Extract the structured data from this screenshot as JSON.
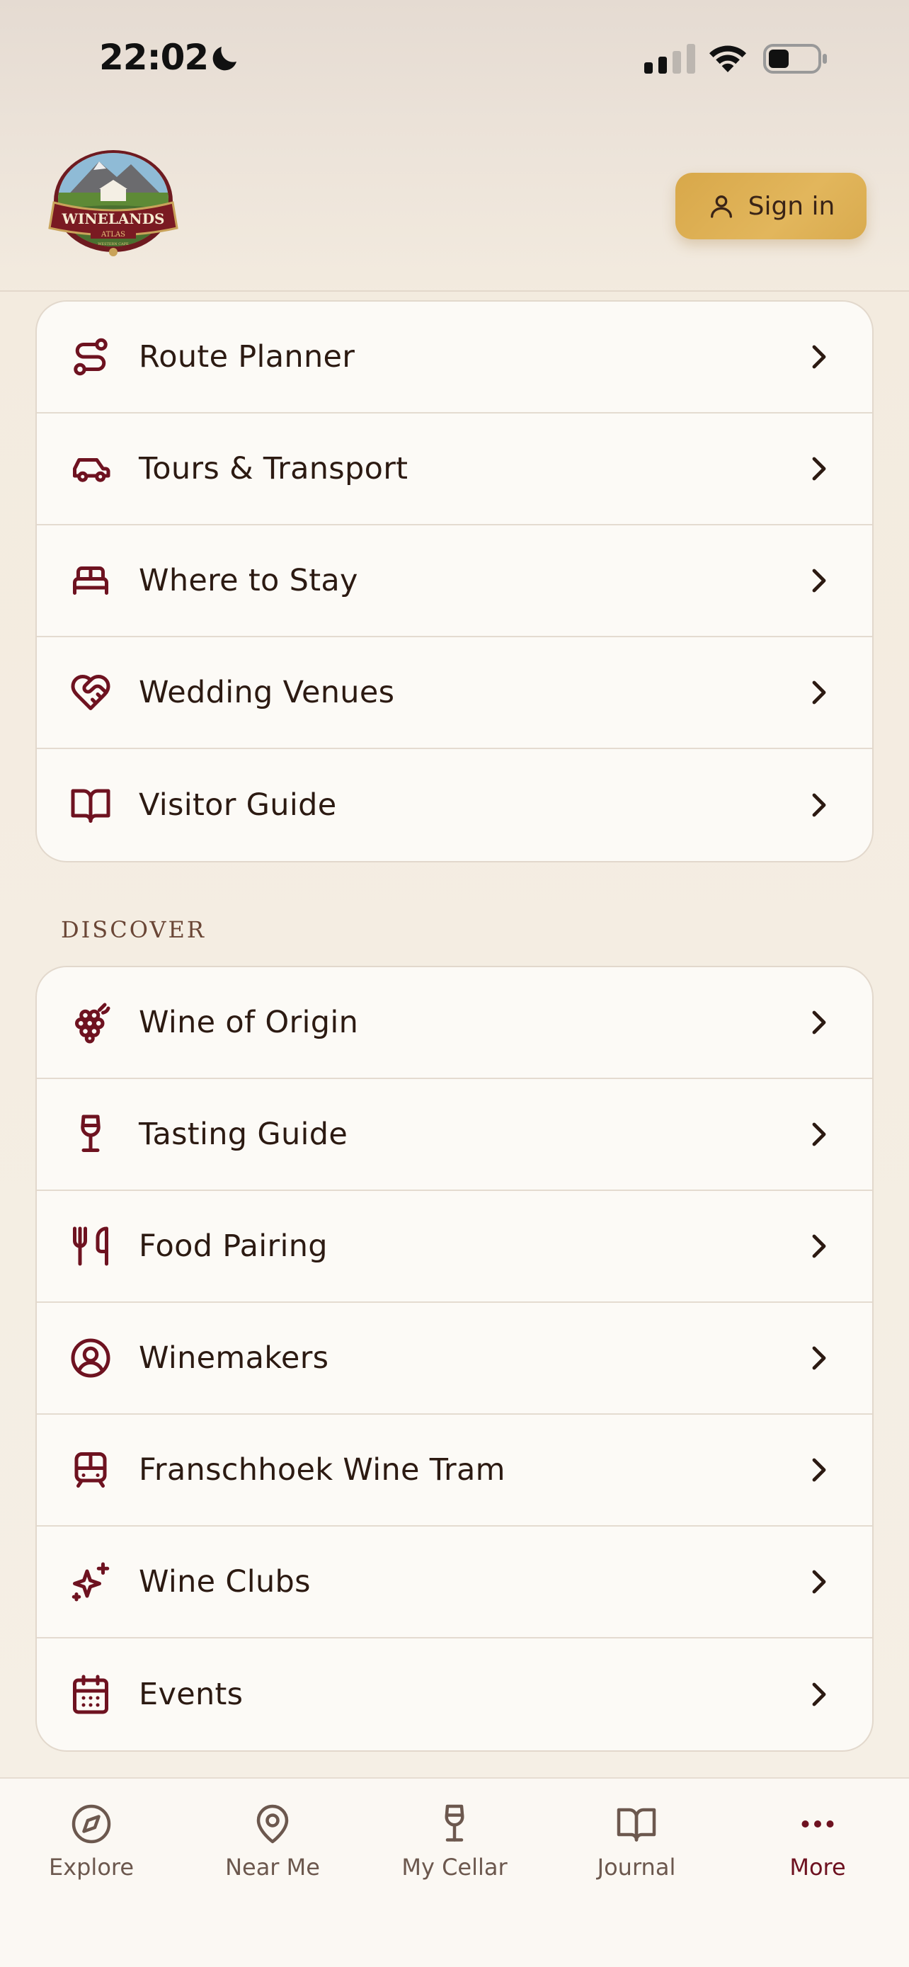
{
  "status_bar": {
    "time": "22:02"
  },
  "header": {
    "logo_top": "WINELANDS",
    "logo_bottom": "ATLAS",
    "logo_sub": "WESTERN CAPE",
    "signin_label": "Sign in"
  },
  "menu_group_1": [
    {
      "label": "Route Planner",
      "icon": "route-icon"
    },
    {
      "label": "Tours & Transport",
      "icon": "car-icon"
    },
    {
      "label": "Where to Stay",
      "icon": "bed-icon"
    },
    {
      "label": "Wedding Venues",
      "icon": "heart-handshake-icon"
    },
    {
      "label": "Visitor Guide",
      "icon": "book-open-icon"
    }
  ],
  "discover": {
    "title": "DISCOVER",
    "items": [
      {
        "label": "Wine of Origin",
        "icon": "grapes-icon"
      },
      {
        "label": "Tasting Guide",
        "icon": "wine-glass-icon"
      },
      {
        "label": "Food Pairing",
        "icon": "utensils-icon"
      },
      {
        "label": "Winemakers",
        "icon": "user-circle-icon"
      },
      {
        "label": "Franschhoek Wine Tram",
        "icon": "tram-icon"
      },
      {
        "label": "Wine Clubs",
        "icon": "sparkles-icon"
      },
      {
        "label": "Events",
        "icon": "calendar-icon"
      }
    ]
  },
  "tabbar": {
    "tabs": [
      {
        "label": "Explore",
        "icon": "compass-icon"
      },
      {
        "label": "Near Me",
        "icon": "map-pin-icon"
      },
      {
        "label": "My Cellar",
        "icon": "wine-glass-icon"
      },
      {
        "label": "Journal",
        "icon": "book-open-icon"
      },
      {
        "label": "More",
        "icon": "more-dots-icon",
        "active": true
      }
    ]
  },
  "colors": {
    "accent": "#6e1220",
    "gold": "#dcae50",
    "text": "#2c1a12"
  }
}
